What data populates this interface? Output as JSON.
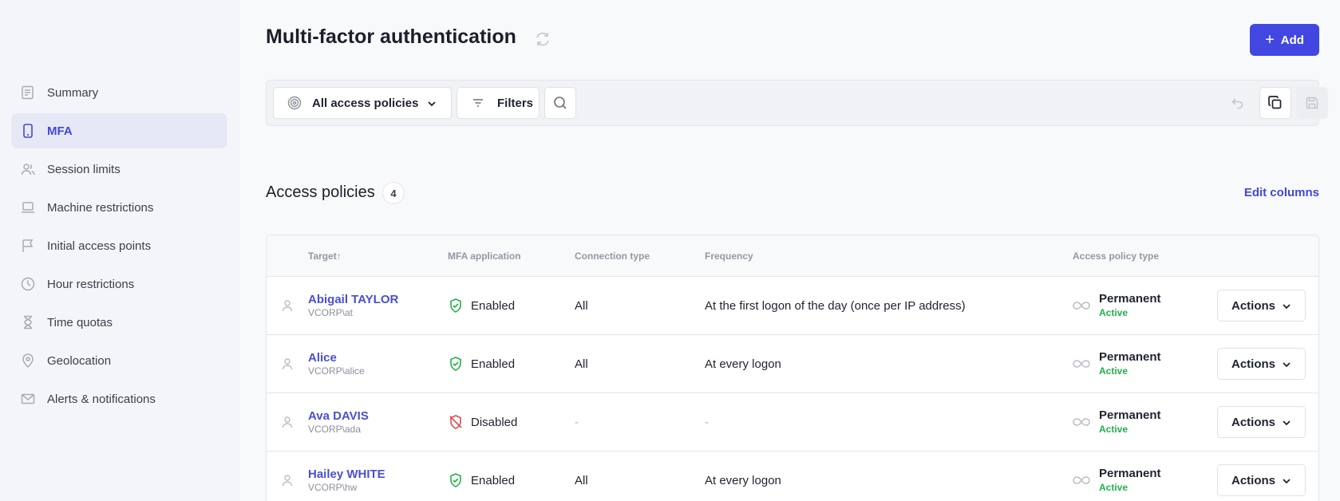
{
  "sidebar": {
    "items": [
      {
        "label": "Summary",
        "icon": "summary-icon"
      },
      {
        "label": "MFA",
        "icon": "phone-icon",
        "active": true
      },
      {
        "label": "Session limits",
        "icon": "users-icon"
      },
      {
        "label": "Machine restrictions",
        "icon": "laptop-icon"
      },
      {
        "label": "Initial access points",
        "icon": "flag-icon"
      },
      {
        "label": "Hour restrictions",
        "icon": "clock-icon"
      },
      {
        "label": "Time quotas",
        "icon": "hourglass-icon"
      },
      {
        "label": "Geolocation",
        "icon": "map-pin-icon"
      },
      {
        "label": "Alerts & notifications",
        "icon": "mail-icon"
      }
    ]
  },
  "header": {
    "title": "Multi-factor authentication",
    "add_label": "Add"
  },
  "toolbar": {
    "policy_select": "All access policies",
    "filters_label": "Filters"
  },
  "section": {
    "title": "Access policies",
    "count": "4",
    "edit_columns": "Edit columns"
  },
  "table": {
    "columns": {
      "target": "Target",
      "target_sort": "↑",
      "mfa": "MFA application",
      "connection": "Connection type",
      "frequency": "Frequency",
      "policy_type": "Access policy type"
    },
    "rows": [
      {
        "name": "Abigail TAYLOR",
        "login": "VCORP\\at",
        "mfa": "Enabled",
        "connection": "All",
        "frequency": "At the first logon of the day (once per IP address)",
        "type": "Permanent",
        "status": "Active",
        "action": "Actions"
      },
      {
        "name": "Alice",
        "login": "VCORP\\alice",
        "mfa": "Enabled",
        "connection": "All",
        "frequency": "At every logon",
        "type": "Permanent",
        "status": "Active",
        "action": "Actions"
      },
      {
        "name": "Ava DAVIS",
        "login": "VCORP\\ada",
        "mfa": "Disabled",
        "connection": "-",
        "frequency": "-",
        "type": "Permanent",
        "status": "Active",
        "action": "Actions"
      },
      {
        "name": "Hailey WHITE",
        "login": "VCORP\\hw",
        "mfa": "Enabled",
        "connection": "All",
        "frequency": "At every logon",
        "type": "Permanent",
        "status": "Active",
        "action": "Actions"
      }
    ]
  },
  "colors": {
    "accent": "#4147e0",
    "link": "#4a4fd4",
    "success": "#22b04b",
    "danger": "#e5484d"
  }
}
